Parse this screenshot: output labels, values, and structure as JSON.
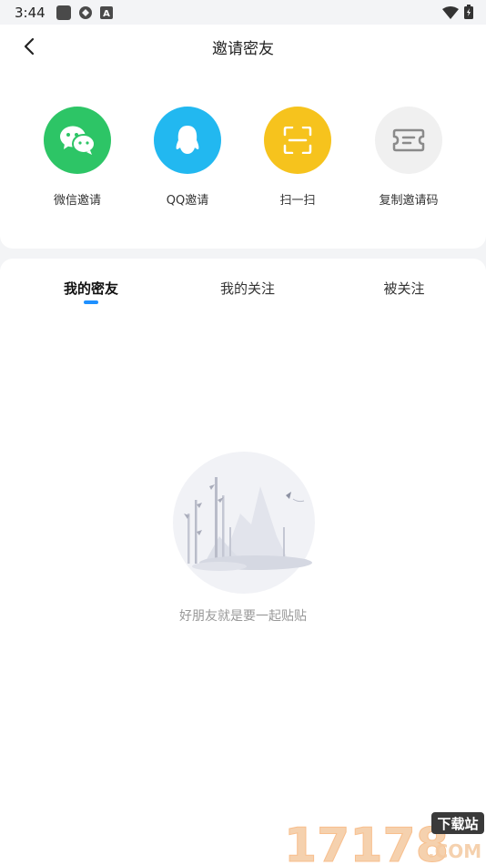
{
  "status_bar": {
    "time": "3:44",
    "icons": [
      "app-square-icon",
      "sync-icon",
      "a-badge-icon",
      "wifi-icon",
      "battery-icon"
    ]
  },
  "header": {
    "title": "邀请密友"
  },
  "share_options": [
    {
      "label": "微信邀请",
      "icon": "wechat-icon",
      "color": "#2dc566"
    },
    {
      "label": "QQ邀请",
      "icon": "qq-icon",
      "color": "#22b8f0"
    },
    {
      "label": "扫一扫",
      "icon": "scan-icon",
      "color": "#f6c31d"
    },
    {
      "label": "复制邀请码",
      "icon": "ticket-icon",
      "color": "#f0f0f0"
    }
  ],
  "tabs": [
    {
      "label": "我的密友",
      "active": true
    },
    {
      "label": "我的关注",
      "active": false
    },
    {
      "label": "被关注",
      "active": false
    }
  ],
  "empty_state": {
    "message": "好朋友就是要一起贴贴"
  },
  "watermark": {
    "text_main": "17178",
    "text_badge": "下载站",
    "text_domain": ".COM"
  },
  "colors": {
    "accent": "#1e90ff",
    "background": "#f3f4f6"
  }
}
